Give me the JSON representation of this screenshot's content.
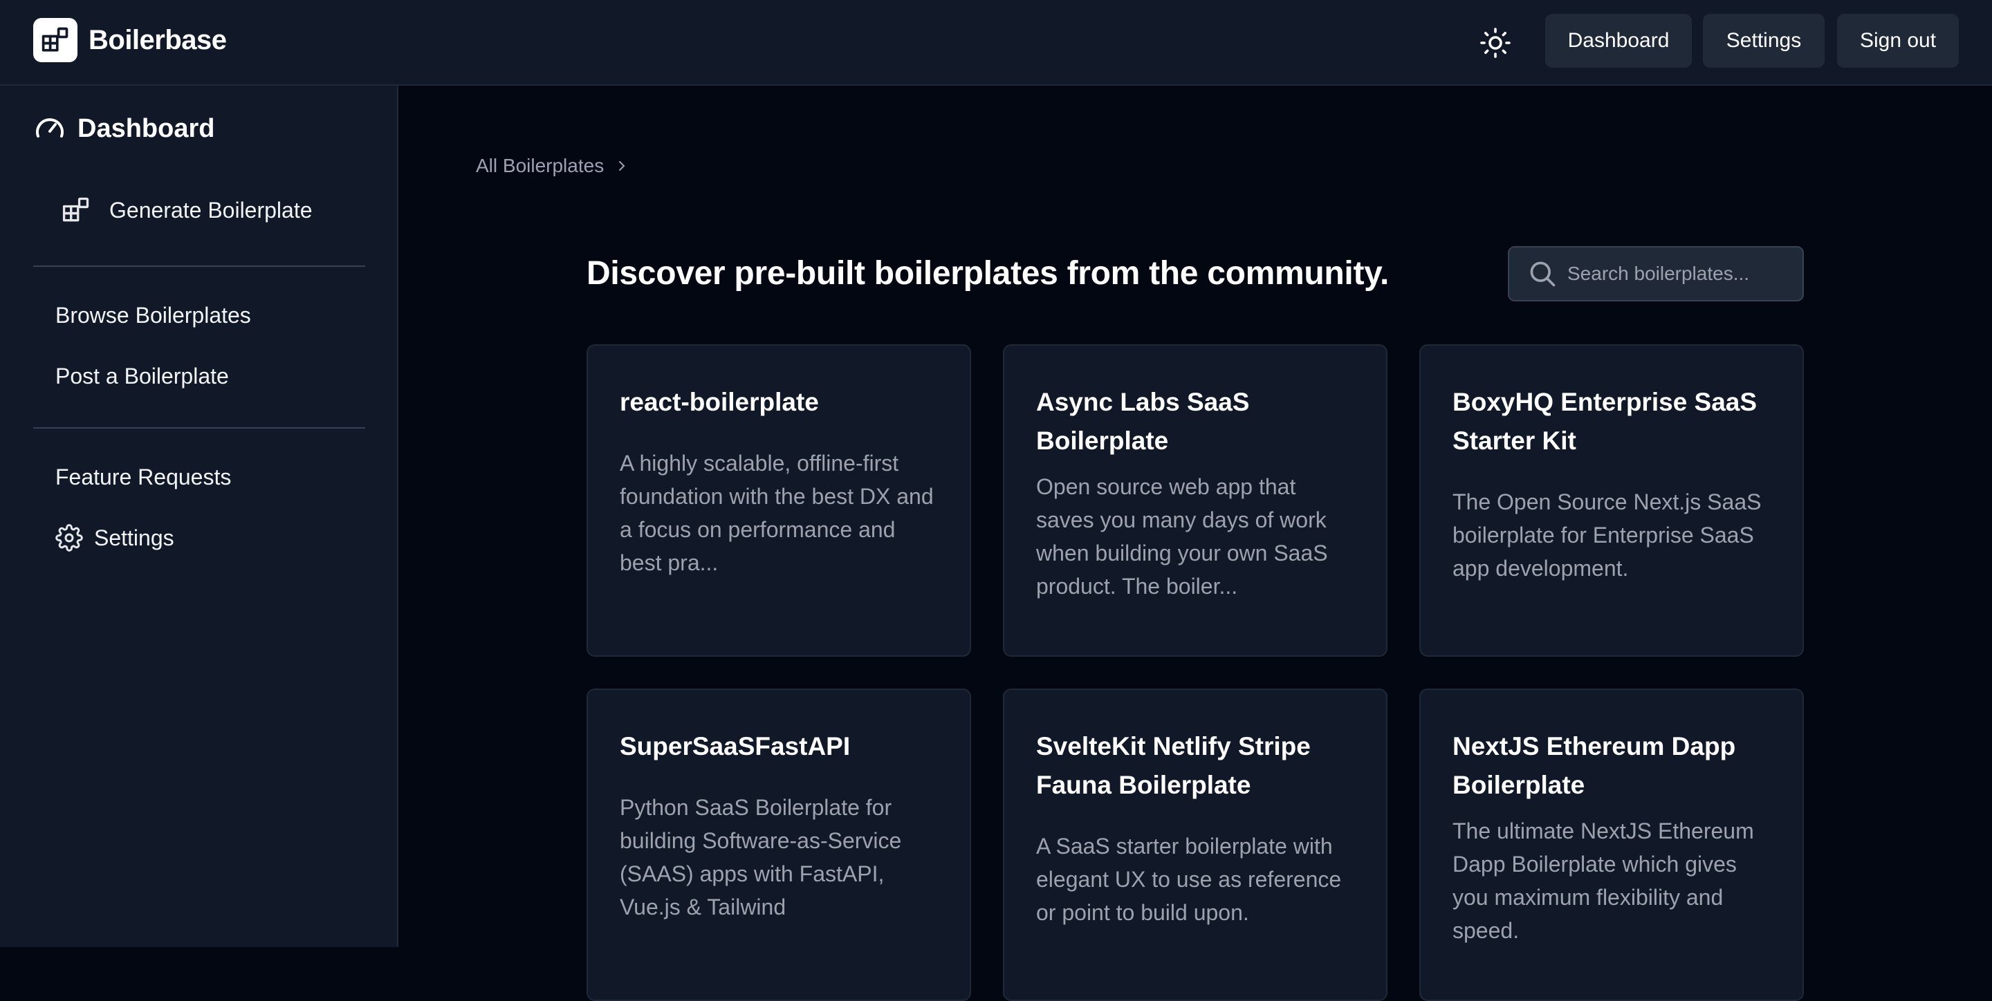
{
  "header": {
    "brand": "Boilerbase",
    "nav": [
      {
        "label": "Dashboard"
      },
      {
        "label": "Settings"
      },
      {
        "label": "Sign out"
      }
    ]
  },
  "sidebar": {
    "title": "Dashboard",
    "generate": "Generate Boilerplate",
    "browse": "Browse Boilerplates",
    "post": "Post a Boilerplate",
    "features": "Feature Requests",
    "settings": "Settings"
  },
  "main": {
    "breadcrumb": "All Boilerplates",
    "headline": "Discover pre-built boilerplates from the community.",
    "search_placeholder": "Search boilerplates...",
    "cards": [
      {
        "title": "react-boilerplate",
        "description": "A highly scalable, offline-first foundation with the best DX and a focus on performance and best pra..."
      },
      {
        "title": "Async Labs SaaS Boilerplate",
        "description": "Open source web app that saves you many days of work when building your own SaaS product. The boiler..."
      },
      {
        "title": "BoxyHQ Enterprise SaaS Starter Kit",
        "description": "The Open Source Next.js SaaS boilerplate for Enterprise SaaS app development."
      },
      {
        "title": "SuperSaaSFastAPI",
        "description": "Python SaaS Boilerplate for building Software-as-Service (SAAS) apps with FastAPI, Vue.js & Tailwind"
      },
      {
        "title": "SvelteKit Netlify Stripe Fauna Boilerplate",
        "description": "A SaaS starter boilerplate with elegant UX to use as reference or point to build upon."
      },
      {
        "title": "NextJS Ethereum Dapp Boilerplate",
        "description": "The ultimate NextJS Ethereum Dapp Boilerplate which gives you maximum flexibility and speed."
      }
    ]
  }
}
